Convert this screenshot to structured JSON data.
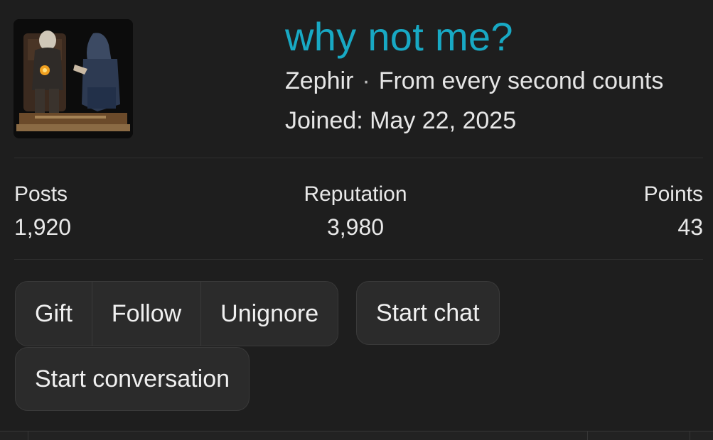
{
  "profile": {
    "username": "why not me?",
    "display_name": "Zephir",
    "separator": "·",
    "tagline": "From every second counts",
    "joined": "Joined: May 22, 2025",
    "accent_color": "#18a9c4",
    "avatar_icon": "assassin-statue-avatar"
  },
  "stats": [
    {
      "label": "Posts",
      "value": "1,920"
    },
    {
      "label": "Reputation",
      "value": "3,980"
    },
    {
      "label": "Points",
      "value": "43"
    }
  ],
  "actions": {
    "gift": "Gift",
    "follow": "Follow",
    "unignore": "Unignore",
    "start_chat": "Start chat",
    "start_conversation": "Start conversation"
  }
}
